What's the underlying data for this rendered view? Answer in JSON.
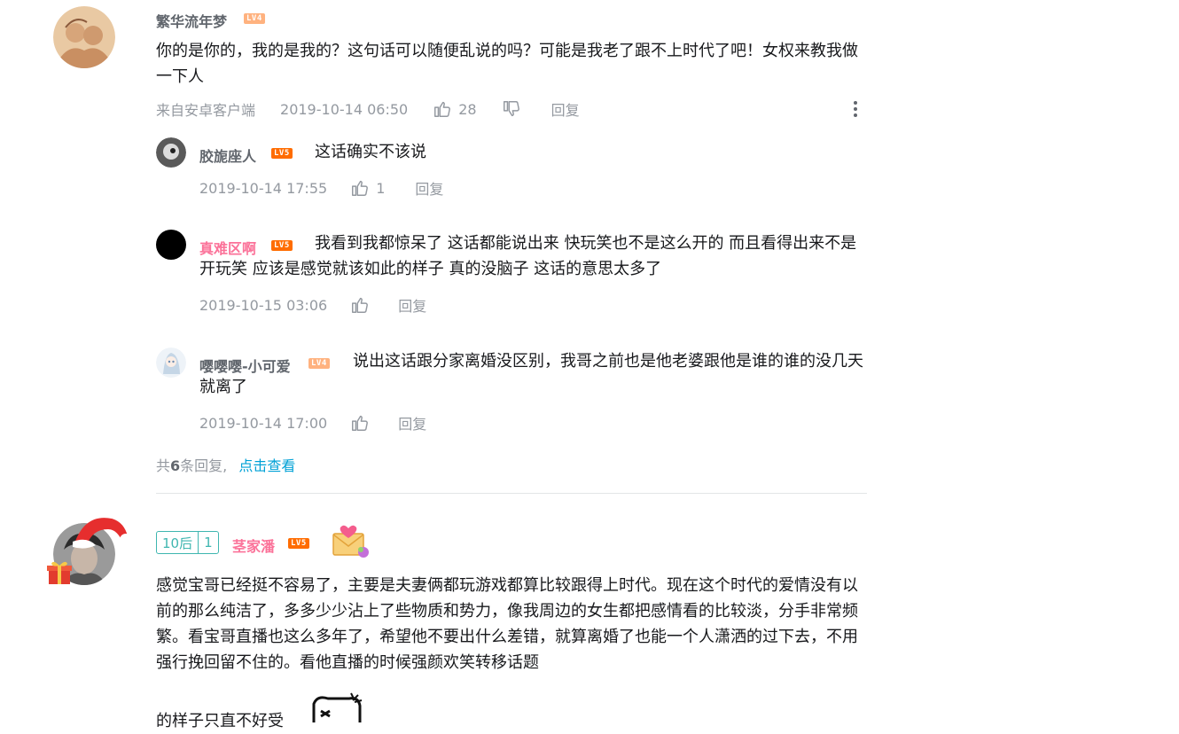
{
  "comments": [
    {
      "username": "繁华流年梦",
      "level": "LV4",
      "text": "你的是你的，我的是我的？这句话可以随便乱说的吗？可能是我老了跟不上时代了吧！女权来教我做一下人",
      "source": "来自安卓客户端",
      "time": "2019-10-14 06:50",
      "likes": "28",
      "reply_label": "回复",
      "replies": [
        {
          "username": "胶旎座人",
          "level": "LV5",
          "text": "这话确实不该说",
          "time": "2019-10-14 17:55",
          "likes": "1",
          "reply_label": "回复"
        },
        {
          "username": "真难区啊",
          "level": "LV5",
          "text": "我看到我都惊呆了 这话都能说出来 快玩笑也不是这么开的 而且看得出来不是开玩笑 应该是感觉就该如此的样子 真的没脑子 这话的意思太多了",
          "time": "2019-10-15 03:06",
          "reply_label": "回复"
        },
        {
          "username": "嘤嘤嘤-小可爱",
          "level": "LV4",
          "text": "说出这话跟分家离婚没区别，我哥之前也是他老婆跟他是谁的谁的没几天就离了",
          "time": "2019-10-14 17:00",
          "reply_label": "回复"
        }
      ],
      "replies_summary": {
        "prefix": "共",
        "count": "6",
        "suffix": "条回复,",
        "link": "点击查看"
      }
    },
    {
      "badge": [
        "10后",
        "1"
      ],
      "username": "茎家潘",
      "level": "LV5",
      "text": "感觉宝哥已经挺不容易了，主要是夫妻俩都玩游戏都算比较跟得上时代。现在这个时代的爱情没有以前的那么纯洁了，多多少少沾上了些物质和势力，像我周边的女生都把感情看的比较淡，分手非常频繁。看宝哥直播也这么多年了，希望他不要出什么差错，就算离婚了也能一个人潇洒的过下去，不用强行挽回留不住的。看他直播的时候强颜欢笑转移话题",
      "text_cut": "的样子只直不好受"
    }
  ],
  "colors": {
    "pink_name": "#fb7299",
    "link": "#00a1d6",
    "lv4": "#ffb27f",
    "lv5": "#ff6c00",
    "badge": "#3fb6b0"
  }
}
